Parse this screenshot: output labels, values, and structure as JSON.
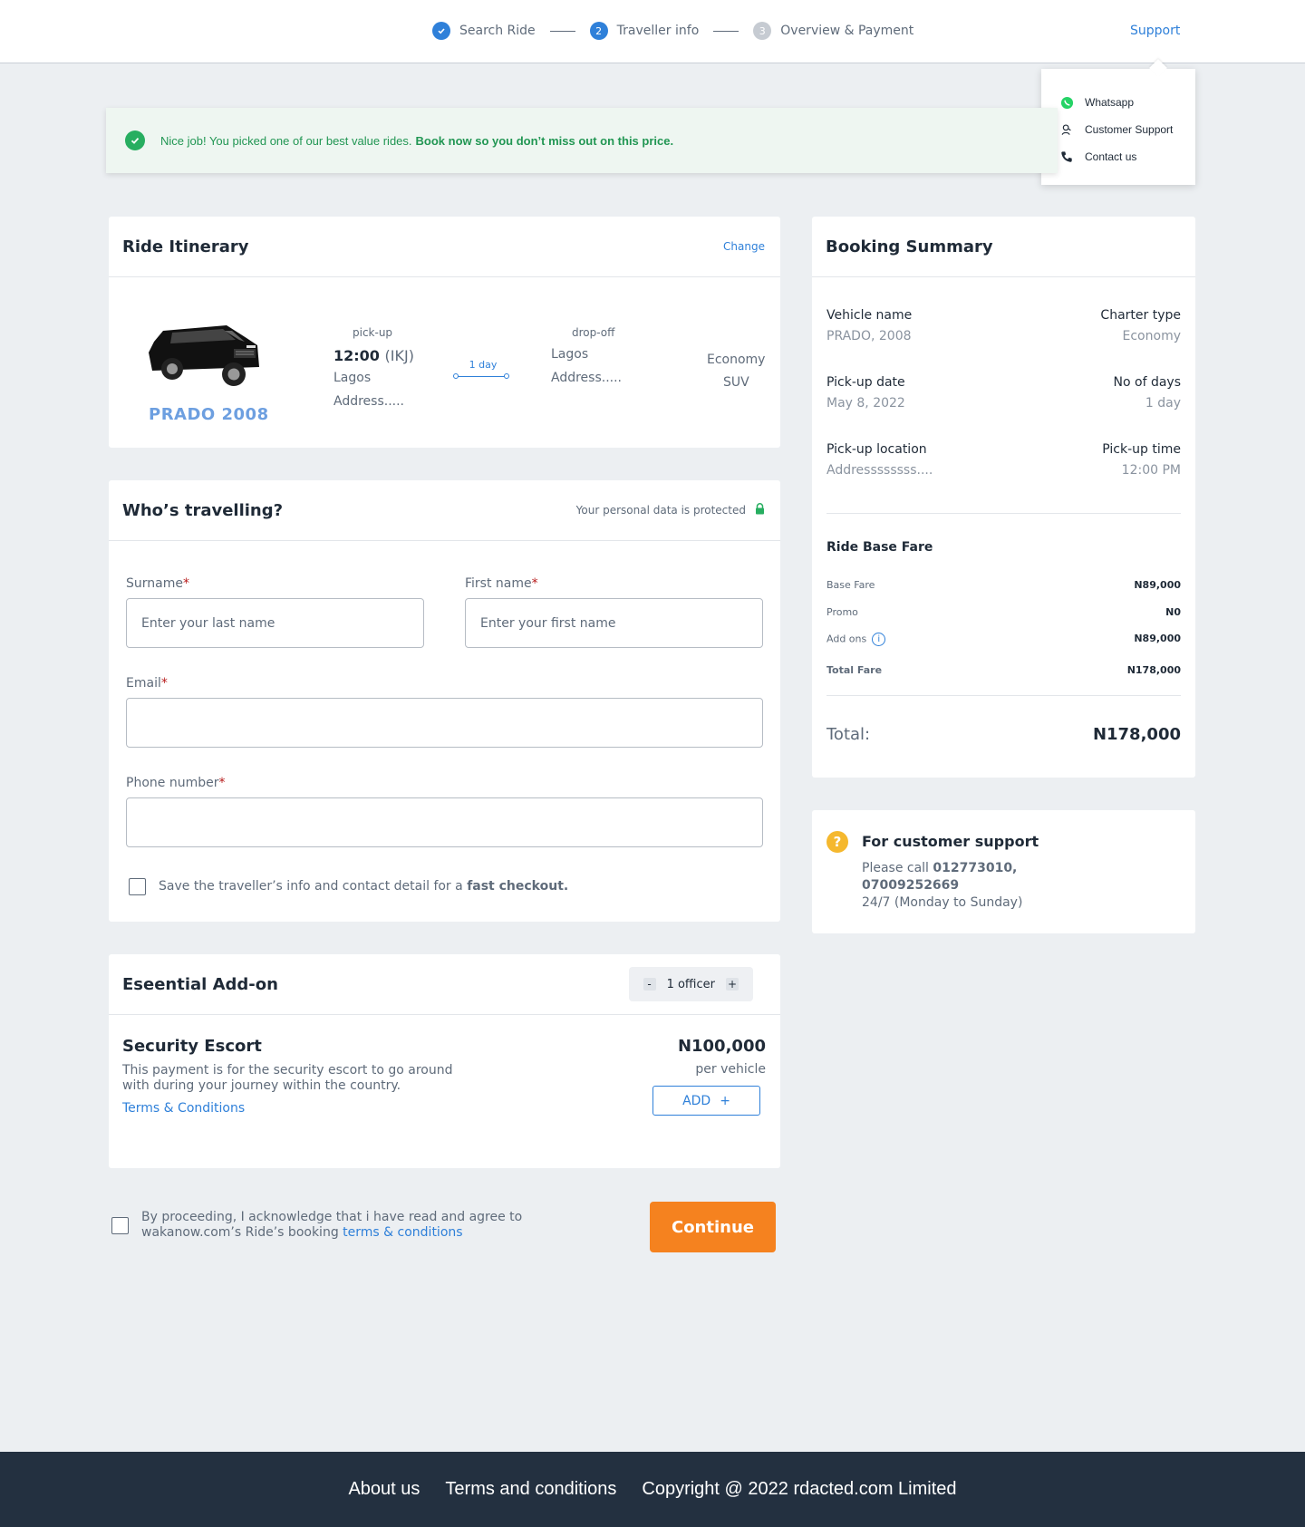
{
  "header": {
    "steps": [
      {
        "number": "",
        "label": "Search Ride",
        "state": "done"
      },
      {
        "number": "2",
        "label": "Traveller info",
        "state": "active"
      },
      {
        "number": "3",
        "label": "Overview & Payment",
        "state": "todo"
      }
    ],
    "support_label": "Support"
  },
  "support_menu": {
    "items": [
      {
        "label": "Whatsapp",
        "icon": "whatsapp-icon"
      },
      {
        "label": "Customer Support",
        "icon": "headset-icon"
      },
      {
        "label": "Contact us",
        "icon": "phone-icon"
      }
    ]
  },
  "banner": {
    "text": "Nice job! You picked one of our best value rides.",
    "bold": "Book now so you don’t miss out on this price."
  },
  "itinerary": {
    "title": "Ride Itinerary",
    "change_label": "Change",
    "vehicle": "PRADO 2008",
    "pickup_label": "pick-up",
    "pickup_time": "12:00",
    "pickup_code": "(IKJ)",
    "pickup_city": "Lagos",
    "pickup_address": "Address.....",
    "duration": "1 day",
    "dropoff_label": "drop-off",
    "dropoff_city": "Lagos",
    "dropoff_address": "Address.....",
    "class_line1": "Economy",
    "class_line2": "SUV"
  },
  "travellers": {
    "title": "Who’s travelling?",
    "protected": "Your personal data is protected",
    "surname_label": "Surname",
    "surname_placeholder": "Enter your last name",
    "first_label": "First name",
    "first_placeholder": "Enter your first name",
    "email_label": "Email",
    "phone_label": "Phone number",
    "required_mark": "*",
    "save_text": "Save the traveller’s info and contact detail for a",
    "save_bold": "fast checkout."
  },
  "addon": {
    "title": "Eseential Add-on",
    "stepper_minus": "-",
    "stepper_value": "1 officer",
    "stepper_plus": "+",
    "name": "Security Escort",
    "description": "This payment is for the security escort to go around with during your journey within the country.",
    "terms": "Terms & Conditions",
    "price": "N100,000",
    "per": "per vehicle",
    "add_label": "ADD",
    "add_icon": "+"
  },
  "agreement": {
    "text": "By proceeding, I acknowledge that i have read and agree to wakanow.com’s Ride’s booking",
    "link": "terms & conditions",
    "continue_label": "Continue"
  },
  "summary": {
    "title": "Booking Summary",
    "rows": [
      {
        "left_key": "Vehicle name",
        "left_val": "PRADO, 2008",
        "right_key": "Charter type",
        "right_val": "Economy"
      },
      {
        "left_key": "Pick-up date",
        "left_val": "May 8, 2022",
        "right_key": "No of days",
        "right_val": "1 day"
      },
      {
        "left_key": "Pick-up location",
        "left_val": "Addressssssss....",
        "right_key": "Pick-up time",
        "right_val": "12:00 PM"
      }
    ],
    "fare_title": "Ride Base Fare",
    "fares": [
      {
        "label": "Base Fare",
        "value": "N89,000"
      },
      {
        "label": "Promo",
        "value": "N0"
      },
      {
        "label": "Add ons",
        "value": "N89,000"
      },
      {
        "label": "Total Fare",
        "value": "N178,000"
      }
    ],
    "total_label": "Total:",
    "total_value": "N178,000"
  },
  "customer_support": {
    "icon": "?",
    "title": "For customer support",
    "call_prefix": "Please call",
    "phone1": "012773010,",
    "phone2": "07009252669",
    "hours": "24/7 (Monday to Sunday)"
  },
  "footer": {
    "links": [
      "About us",
      "Terms and conditions",
      "Copyright @ 2022 rdacted.com Limited"
    ]
  },
  "colors": {
    "accent": "#2f80d9",
    "success": "#27ae60",
    "cta": "#f5821f",
    "footer": "#233040"
  }
}
